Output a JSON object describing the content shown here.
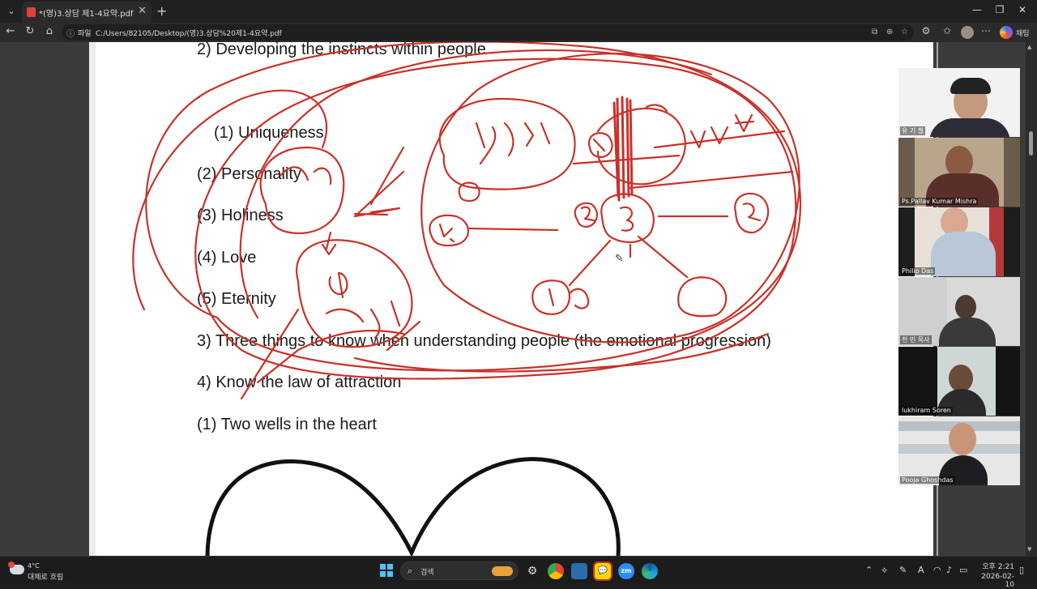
{
  "browser": {
    "tab_title": "*(영)3.상담 제1-4요약.pdf",
    "tab_close": "✕",
    "new_tab": "+",
    "tab_menu": "⌄",
    "window_controls": {
      "minimize": "—",
      "restore": "❐",
      "close": "✕"
    },
    "nav": {
      "back": "←",
      "reload": "↻",
      "home": "⌂"
    },
    "scheme_label": "파일",
    "url": "C:/Users/82105/Desktop/(영)3.상담%20제1-4요약.pdf",
    "copilot_label": "채팅"
  },
  "document": {
    "lines": [
      "2) Developing the instincts within people",
      ".",
      "(1) Uniqueness",
      "(2) Personality",
      "(3) Holiness",
      "(4) Love",
      "(5) Eternity",
      "3) Three things to know when understanding people (the emotional progression)",
      "4) Know the law of attraction",
      "(1) Two wells in the heart"
    ],
    "annotation_color": "#c8322a"
  },
  "participants": [
    {
      "name": "유 기 철"
    },
    {
      "name": "Ps.Pallav Kumar Mishra"
    },
    {
      "name": "Philip Das"
    },
    {
      "name": "천 민 목사"
    },
    {
      "name": "lukhiram Soren"
    },
    {
      "name": "Pooja Ghoshdas"
    }
  ],
  "taskbar": {
    "weather_temp": "4°C",
    "weather_condition": "대체로 흐림",
    "weather_badge": "6",
    "search_placeholder": "검색",
    "time": "오후 2:21",
    "date": "2026-02-10",
    "zoom_label": "zm"
  }
}
